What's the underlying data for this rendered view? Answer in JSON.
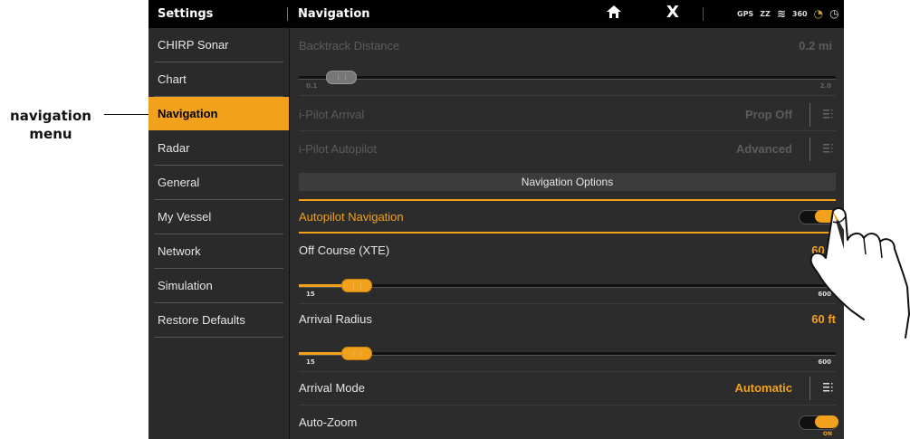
{
  "callout": {
    "line1": "navigation",
    "line2": "menu"
  },
  "topbar": {
    "settings": "Settings",
    "navigation": "Navigation",
    "close": "X",
    "status": {
      "gps": "GPS",
      "zz": "ZZ",
      "sonar": "≋",
      "s360": "360",
      "chart": "◔",
      "clock": "◷"
    }
  },
  "sidebar": {
    "items": [
      {
        "label": "CHIRP Sonar"
      },
      {
        "label": "Chart"
      },
      {
        "label": "Navigation"
      },
      {
        "label": "Radar"
      },
      {
        "label": "General"
      },
      {
        "label": "My Vessel"
      },
      {
        "label": "Network"
      },
      {
        "label": "Simulation"
      },
      {
        "label": "Restore Defaults"
      }
    ],
    "active_index": 2
  },
  "nav": {
    "backtrack": {
      "label": "Backtrack Distance",
      "value": "0.2 mi",
      "min": "0.1",
      "max": "2.0",
      "level": 0.05
    },
    "ipilot_arrival": {
      "label": "i-Pilot Arrival",
      "value": "Prop Off"
    },
    "ipilot_autopilot": {
      "label": "i-Pilot Autopilot",
      "value": "Advanced"
    },
    "section": "Navigation Options",
    "autopilot_nav": {
      "label": "Autopilot Navigation",
      "state": "on"
    },
    "off_course": {
      "label": "Off Course (XTE)",
      "value": "60 ft",
      "min": "15",
      "max": "600",
      "level": 0.08
    },
    "arrival_radius": {
      "label": "Arrival Radius",
      "value": "60 ft",
      "min": "15",
      "max": "600",
      "level": 0.08
    },
    "arrival_mode": {
      "label": "Arrival Mode",
      "value": "Automatic"
    },
    "auto_zoom": {
      "label": "Auto-Zoom",
      "state": "ON"
    }
  },
  "colors": {
    "accent": "#f1a11c",
    "background": "#2c2c2c",
    "topbar": "#000000"
  }
}
